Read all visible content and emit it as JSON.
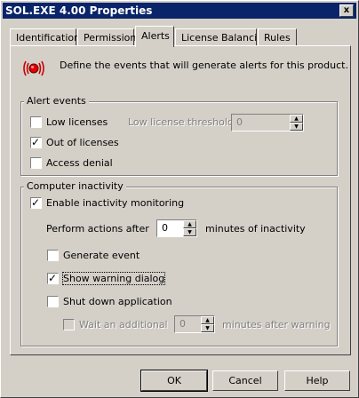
{
  "window": {
    "title": "SOL.EXE 4.00 Properties",
    "close_glyph": "x"
  },
  "tabs": [
    {
      "label": "Identification"
    },
    {
      "label": "Permissions"
    },
    {
      "label": "Alerts",
      "active": true
    },
    {
      "label": "License Balancing"
    },
    {
      "label": "Rules"
    }
  ],
  "intro": {
    "icon": "alarm-icon",
    "text": "Define the events that will generate alerts for this product."
  },
  "alert_events": {
    "legend": "Alert events",
    "low_licenses": {
      "label": "Low licenses",
      "checked": false
    },
    "threshold_label": "Low license threshold:",
    "threshold_value": "0",
    "out_of_licenses": {
      "label": "Out of licenses",
      "checked": true
    },
    "access_denial": {
      "label": "Access denial",
      "checked": false
    }
  },
  "inactivity": {
    "legend": "Computer inactivity",
    "enable": {
      "label": "Enable inactivity monitoring",
      "checked": true
    },
    "perform_label": "Perform actions after",
    "perform_value": "0",
    "minutes_label": "minutes of inactivity",
    "generate_event": {
      "label": "Generate event",
      "checked": false
    },
    "show_warning": {
      "label": "Show warning dialog",
      "checked": true
    },
    "shut_down": {
      "label": "Shut down application",
      "checked": false
    },
    "wait_additional": {
      "label": "Wait an additional",
      "checked": false
    },
    "wait_value": "0",
    "after_warning_label": "minutes after warning"
  },
  "buttons": {
    "ok": "OK",
    "cancel": "Cancel",
    "help": "Help"
  },
  "colors": {
    "titlebar": "#0a246a",
    "face": "#d4d0c8",
    "alarm_red": "#cc0000"
  }
}
